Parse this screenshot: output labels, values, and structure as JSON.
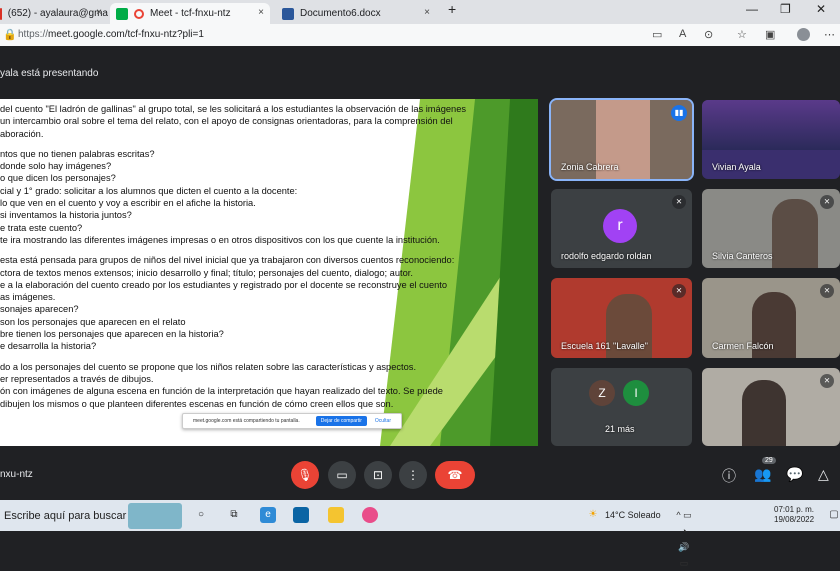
{
  "browser": {
    "tabs": [
      {
        "title": "(652) - ayalaura@gma",
        "close": "×"
      },
      {
        "title": "Meet - tcf-fnxu-ntz",
        "close": "×"
      },
      {
        "title": "Documento6.docx",
        "close": "×"
      }
    ],
    "new_tab": "+",
    "window_controls": [
      "—",
      "❐",
      "✕"
    ],
    "url_prefix": "https://",
    "url": "meet.google.com/tcf-fnxu-ntz?pli=1"
  },
  "meet": {
    "presenting": "yala está presentando",
    "meeting_code": "nxu-ntz",
    "slide_lines": [
      "del cuento \"El ladrón de gallinas\" al grupo total, se les solicitará a los estudiantes la observación de las imágenes",
      "un intercambio oral sobre el tema del relato, con el apoyo de consignas orientadoras, para la comprensión del",
      "aboración.",
      "",
      "ntos que no tienen palabras escritas?",
      "donde solo hay imágenes?",
      "o que dicen los personajes?",
      "cial y 1° grado: solicitar a los alumnos que dicten el cuento a la docente:",
      "lo que ven en el cuento y voy a escribir en el afiche la historia.",
      "si inventamos la historia juntos?",
      "e trata este cuento?",
      "te ira mostrando las diferentes imágenes impresas o en otros dispositivos con los que cuente la institución.",
      "",
      "esta está pensada para grupos de niños del nivel inicial que ya trabajaron con diversos cuentos reconociendo:",
      "ctora de textos menos extensos; inicio desarrollo y final; título; personajes del cuento, dialogo; autor.",
      "e a la elaboración del cuento creado por los estudiantes y registrado por el docente se reconstruye el cuento",
      "as imágenes.",
      "sonajes aparecen?",
      "son los personajes que aparecen en el relato",
      "bre tienen los personajes que aparecen en la historia?",
      "e desarrolla la historia?",
      "",
      "do a los personajes del cuento se propone que los niños relaten sobre las características y aspectos.",
      "er representados a través de dibujos.",
      "ón con imágenes de alguna escena en función de la interpretación que hayan realizado del texto. Se puede",
      "dibujen los mismos o que planteen diferentes escenas en función de cómo creen ellos que son."
    ],
    "share_popup": {
      "message": "meet.google.com está compartiendo tu pantalla.",
      "stop": "Dejar de compartir",
      "hide": "Ocultar"
    },
    "participants": [
      {
        "name": "Zonia Cabrera"
      },
      {
        "name": "Vivian Ayala"
      },
      {
        "name": "rodolfo edgardo roldan",
        "initial": "r"
      },
      {
        "name": "Silvia Canteros"
      },
      {
        "name": "Escuela 161 \"Lavalle\""
      },
      {
        "name": "Carmen Falcón"
      },
      {
        "name": "21 más",
        "initials": [
          "Z",
          "I"
        ]
      },
      {
        "name": ""
      }
    ],
    "people_count": "29",
    "colors": {
      "avatar_r": "#a142f4",
      "avatar_z": "#5f4339",
      "avatar_i": "#1e8e3e",
      "end_call": "#ea4335",
      "speaker": "#1a73e8"
    }
  },
  "taskbar": {
    "search": "Escribe aquí para buscar",
    "weather": "14°C  Soleado",
    "time": "07:01 p. m.",
    "date": "19/08/2022"
  }
}
